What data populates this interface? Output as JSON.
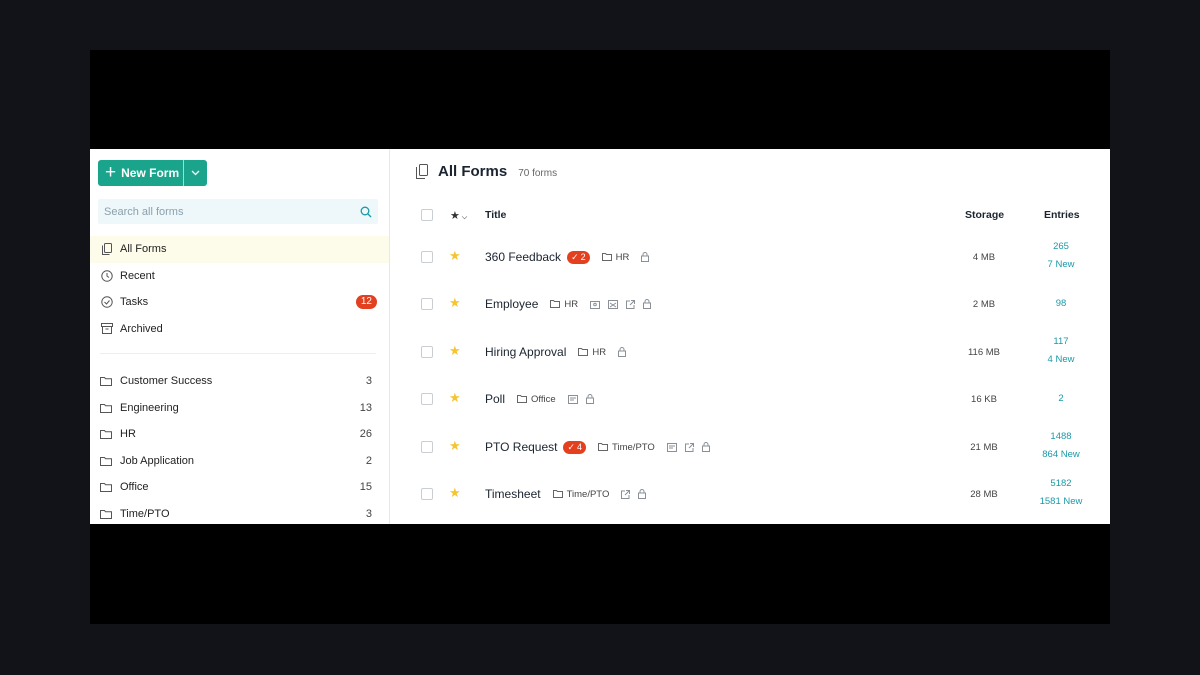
{
  "sidebar": {
    "new_form_label": "New Form",
    "search_placeholder": "Search all forms",
    "nav": [
      {
        "label": "All Forms",
        "icon": "forms-icon"
      },
      {
        "label": "Recent",
        "icon": "clock-icon"
      },
      {
        "label": "Tasks",
        "icon": "check-circle-icon",
        "badge": "12"
      },
      {
        "label": "Archived",
        "icon": "archive-icon"
      }
    ],
    "folders": [
      {
        "label": "Customer Success",
        "count": "3"
      },
      {
        "label": "Engineering",
        "count": "13"
      },
      {
        "label": "HR",
        "count": "26"
      },
      {
        "label": "Job Application",
        "count": "2"
      },
      {
        "label": "Office",
        "count": "15"
      },
      {
        "label": "Time/PTO",
        "count": "3"
      }
    ]
  },
  "main": {
    "title": "All Forms",
    "subtitle": "70 forms",
    "columns": {
      "title": "Title",
      "storage": "Storage",
      "entries": "Entries"
    },
    "rows": [
      {
        "title": "360 Feedback",
        "task_badge": "2",
        "folder": "HR",
        "storage": "4 MB",
        "entries": "265",
        "new_entries": "7 New"
      },
      {
        "title": "Employee",
        "folder": "HR",
        "storage": "2 MB",
        "entries": "98",
        "new_entries": ""
      },
      {
        "title": "Hiring Approval",
        "folder": "HR",
        "storage": "116 MB",
        "entries": "117",
        "new_entries": "4 New"
      },
      {
        "title": "Poll",
        "folder": "Office",
        "storage": "16 KB",
        "entries": "2",
        "new_entries": ""
      },
      {
        "title": "PTO Request",
        "task_badge": "4",
        "folder": "Time/PTO",
        "storage": "21 MB",
        "entries": "1488",
        "new_entries": "864 New"
      },
      {
        "title": "Timesheet",
        "folder": "Time/PTO",
        "storage": "28 MB",
        "entries": "5182",
        "new_entries": "1581 New"
      }
    ]
  },
  "colors": {
    "accent": "#1aa48c",
    "badge": "#e2401f",
    "link": "#1a9aa8",
    "star": "#f5c431"
  }
}
